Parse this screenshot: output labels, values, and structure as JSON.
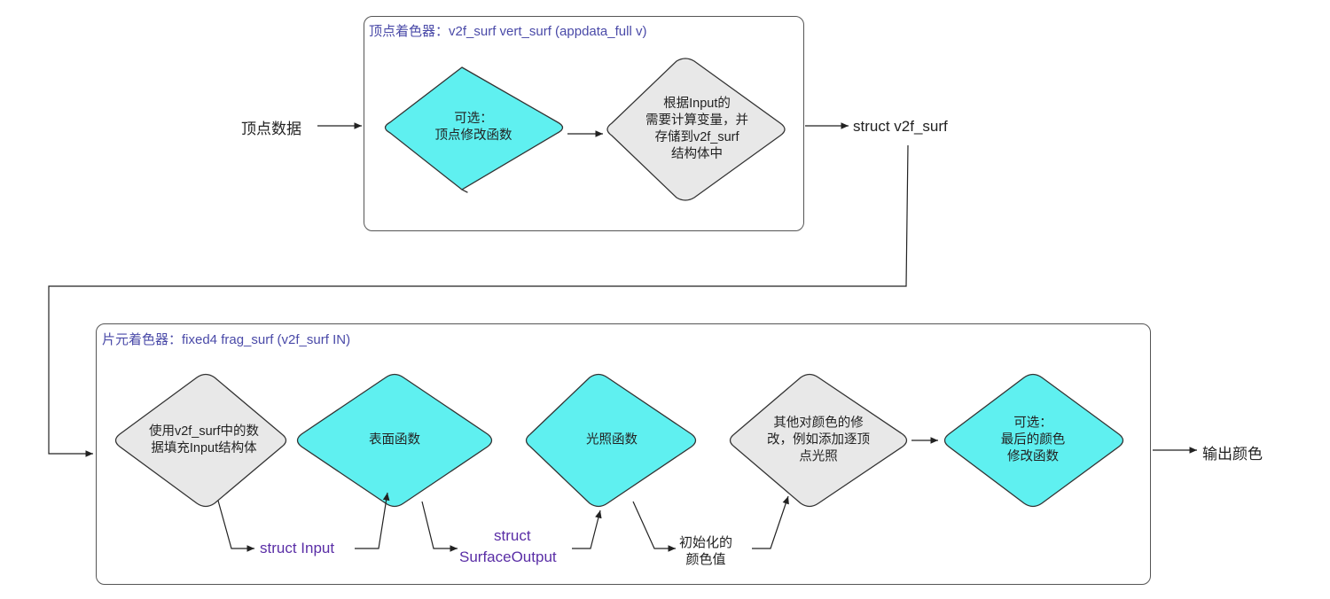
{
  "vertex_panel": {
    "title": "顶点着色器：v2f_surf vert_surf (appdata_full v)"
  },
  "fragment_panel": {
    "title": "片元着色器：fixed4 frag_surf (v2f_surf IN)"
  },
  "labels": {
    "vertex_data": "顶点数据",
    "struct_v2f": "struct v2f_surf",
    "output_color": "输出颜色",
    "struct_input": "struct Input",
    "struct_surface_output_1": "struct",
    "struct_surface_output_2": "SurfaceOutput",
    "initial_color": "初始化的\n颜色值"
  },
  "nodes": {
    "vertex_modify": "可选：\n顶点修改函数",
    "compute_vars": "根据Input的\n需要计算变量，并\n存储到v2f_surf\n结构体中",
    "fill_input": "使用v2f_surf中的数\n据填充Input结构体",
    "surface_func": "表面函数",
    "lighting_func": "光照函数",
    "other_modify": "其他对颜色的修\n改，例如添加逐顶\n点光照",
    "final_color": "可选：\n最后的颜色\n修改函数"
  },
  "colors": {
    "cyan": "#5ff0f0",
    "gray": "#e8e8e8",
    "struct_text": "#5a2ea6",
    "title_text": "#4a4aa8"
  }
}
